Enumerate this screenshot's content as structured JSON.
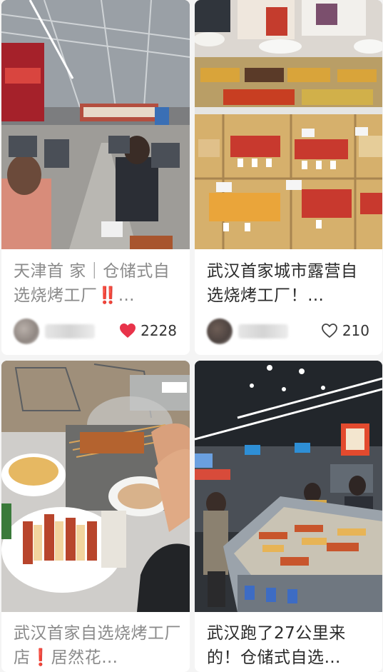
{
  "feed": {
    "cards": [
      {
        "title": "天津首 家｜仓储式自选烧烤工厂‼️…",
        "likes": "2228",
        "liked": true,
        "photo_scene": "warehouse-dining-hall"
      },
      {
        "title": "武汉首家城市露营自选烧烤工厂！…",
        "likes": "210",
        "liked": false,
        "photo_scene": "skewer-display-counter"
      },
      {
        "title": "武汉首家自选烧烤工厂店❗️居然花…",
        "photo_scene": "skewers-on-grill-table"
      },
      {
        "title": "武汉跑了27公里来的！仓储式自选…",
        "photo_scene": "store-interior-self-service"
      }
    ]
  },
  "colors": {
    "heart_filled": "#e8334a",
    "heart_outline": "#444444",
    "title_text": "#2b2b2b",
    "title_faded": "#8a8a8a"
  },
  "icons": [
    "heart-filled-icon",
    "heart-outline-icon",
    "avatar"
  ]
}
